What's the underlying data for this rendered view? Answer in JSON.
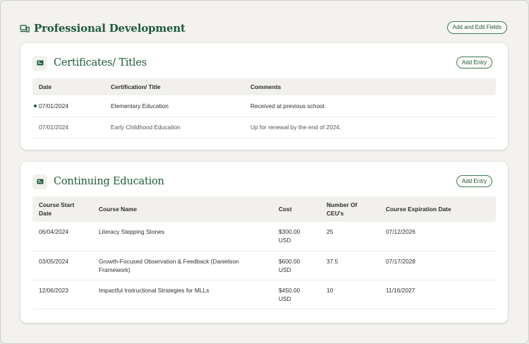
{
  "header": {
    "title": "Professional Development",
    "add_edit_label": "Add and Edit Fields"
  },
  "certificates": {
    "title": "Certificates/ Titles",
    "add_label": "Add Entry",
    "columns": [
      "Date",
      "Certification/ Title",
      "Comments"
    ],
    "rows": [
      {
        "date": "07/01/2024",
        "title": "Elementary Education",
        "comments": "Received at previous school."
      },
      {
        "date": "07/01/2024",
        "title": "Early Childhood Education",
        "comments": "Up for renewal by the end of 2024."
      }
    ]
  },
  "continuing": {
    "title": "Continuing Education",
    "add_label": "Add Entry",
    "columns": [
      "Course Start Date",
      "Course Name",
      "Cost",
      "Number Of CEU's",
      "Course Expiration Date"
    ],
    "rows": [
      {
        "start": "06/04/2024",
        "name": "Literacy Stepping Stones",
        "cost": "$300.00 USD",
        "ceu": "25",
        "expiration": "07/12/2026"
      },
      {
        "start": "03/05/2024",
        "name": "Growth-Focused Observation & Feedback (Danielson Framework)",
        "cost": "$600.00 USD",
        "ceu": "37.5",
        "expiration": "07/17/2028"
      },
      {
        "start": "12/06/2023",
        "name": "Impactful Instructional Strategies for MLLs",
        "cost": "$450.00 USD",
        "ceu": "10",
        "expiration": "11/16/2027"
      }
    ]
  },
  "colors": {
    "accent": "#1f5c3b",
    "background": "#f3f2ee",
    "header_row": "#f1f0ec"
  },
  "icons": {
    "header": "devices-icon",
    "section": "id-card-icon"
  }
}
